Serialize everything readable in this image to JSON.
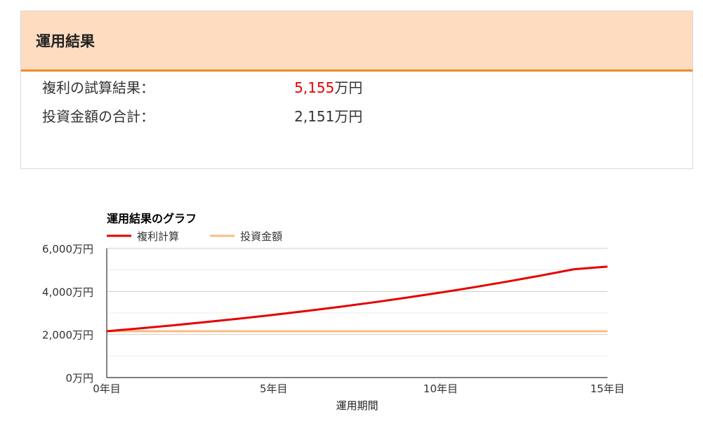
{
  "result": {
    "title": "運用結果",
    "compound_label": "複利の試算結果：",
    "compound_value": "5,155",
    "compound_unit": "万円",
    "invest_label": "投資金額の合計：",
    "invest_value": "2,151万円"
  },
  "colors": {
    "header_bg": "#fddcc0",
    "header_border": "#ef8a2e",
    "highlight_red": "#e60000",
    "compound_line": "#e60000",
    "invest_line": "#f9bc80"
  },
  "chart_data": {
    "type": "line",
    "title": "運用結果のグラフ",
    "xlabel": "運用期間",
    "ylabel": "",
    "x": [
      0,
      1,
      2,
      3,
      4,
      5,
      6,
      7,
      8,
      9,
      10,
      11,
      12,
      13,
      14,
      15
    ],
    "x_ticks": [
      0,
      5,
      10,
      15
    ],
    "x_tick_labels": [
      "0年目",
      "5年目",
      "10年目",
      "15年目"
    ],
    "ylim": [
      0,
      6000
    ],
    "y_ticks": [
      0,
      2000,
      4000,
      6000
    ],
    "y_tick_labels": [
      "0万円",
      "2,000万円",
      "4,000万円",
      "6,000万円"
    ],
    "grid": true,
    "legend_position": "top-left",
    "series": [
      {
        "name": "複利計算",
        "color": "#e60000",
        "values": [
          2151,
          2285,
          2429,
          2581,
          2743,
          2914,
          3097,
          3291,
          3497,
          3716,
          3949,
          4197,
          4460,
          4739,
          5036,
          5155
        ]
      },
      {
        "name": "投資金額",
        "color": "#f9bc80",
        "values": [
          2151,
          2151,
          2151,
          2151,
          2151,
          2151,
          2151,
          2151,
          2151,
          2151,
          2151,
          2151,
          2151,
          2151,
          2151,
          2151
        ]
      }
    ]
  }
}
